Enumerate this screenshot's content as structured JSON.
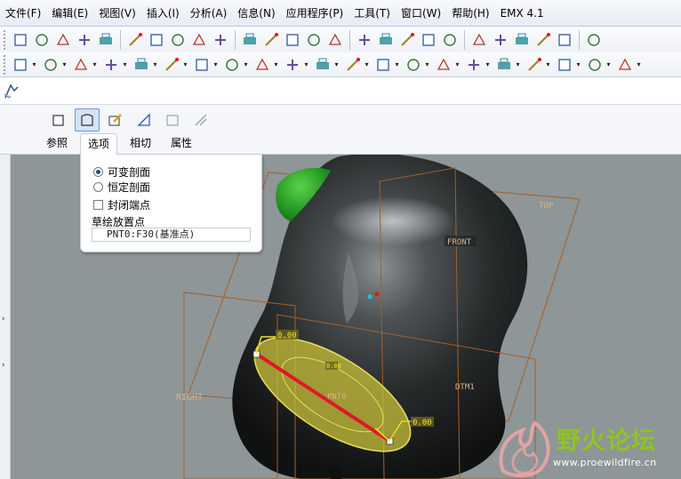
{
  "menubar": {
    "items": [
      "文件(F)",
      "编辑(E)",
      "视图(V)",
      "插入(I)",
      "分析(A)",
      "信息(N)",
      "应用程序(P)",
      "工具(T)",
      "窗口(W)",
      "帮助(H)",
      "EMX 4.1"
    ]
  },
  "toolbar1": {
    "icons": [
      "new-file-icon",
      "open-file-icon",
      "save-icon",
      "undo-icon",
      "redo-icon",
      "cut-icon",
      "copy-icon",
      "paste-icon",
      "paste-special-icon",
      "regenerate-icon",
      "find-icon",
      "select-box-icon",
      "repaint-icon",
      "refit-icon",
      "spin-center-icon",
      "zoom-in-icon",
      "zoom-out-icon",
      "zoom-fit-icon",
      "orient-icon",
      "saved-views-icon",
      "layers-icon",
      "display-style-icon",
      "wireframe-icon",
      "hidden-line-icon",
      "no-hidden-icon",
      "shading-icon"
    ]
  },
  "toolbar2": {
    "icons": [
      "sketch-icon",
      "close-window-icon",
      "datum-plane-icon",
      "datum-axis-icon",
      "datum-point-icon",
      "coordinate-system-icon",
      "emx-plate-icon",
      "emx-guide-icon",
      "emx-bolt-icon",
      "emx-screw-icon",
      "emx-pin-icon",
      "emx-ejector-icon",
      "emx-cooling-icon",
      "emx-slider-icon",
      "emx-lifter-icon",
      "emx-bom-icon",
      "emx-drawing-icon",
      "emx-new-icon",
      "emx-settings-icon",
      "emx-pocket-icon",
      "emx-insert-icon"
    ]
  },
  "dashboard": {
    "tools": [
      "sweep-solid-icon",
      "sweep-surface-icon",
      "sketch-edit-icon",
      "remove-material-icon",
      "thicken-icon",
      "trim-icon"
    ],
    "tabs": [
      "参照",
      "选项",
      "相切",
      "属性"
    ],
    "active_tab": "选项"
  },
  "options": {
    "variable_section": "可变剖面",
    "constant_section": "恒定剖面",
    "selected": "可变剖面",
    "close_ends": "封闭端点",
    "close_ends_checked": false,
    "sketch_placement_label": "草绘放置点",
    "sketch_placement_value": "PNT0:F30(基准点)"
  },
  "viewport": {
    "datum_labels": {
      "top": "TOP",
      "front": "FRONT",
      "right": "RIGHT",
      "dtm1": "DTM1",
      "v_ul": "0.00",
      "center": "0.00",
      "mid": "PNT0",
      "v_lr": "0.00"
    },
    "model_color": "#1c1f1f",
    "ellipse_color": "#c9c13a",
    "trajectory_color": "#e2152a",
    "datum_plane_color": "#a45f2a",
    "background_color": "#8e9697"
  },
  "left_dock": {
    "arrows": [
      "›",
      "›"
    ]
  },
  "watermark": {
    "title": "野火论坛",
    "url": "www.proewildfire.cn"
  }
}
